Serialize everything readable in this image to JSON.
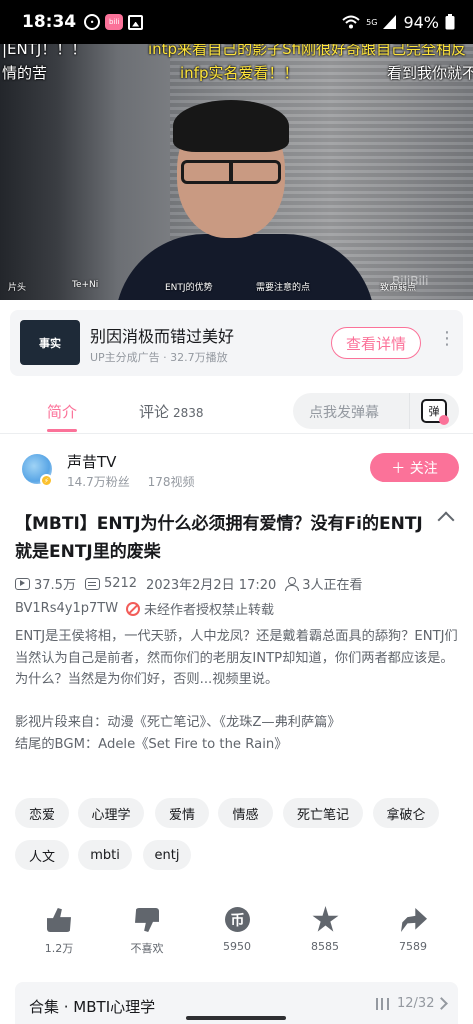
{
  "status_bar": {
    "time": "18:34",
    "network": "5G",
    "battery": "94%",
    "app_badge": "bili",
    "icons": [
      "alarm-icon",
      "bili-notification-icon",
      "image-icon",
      "wifi-icon",
      "signal-icon",
      "battery-icon"
    ]
  },
  "video": {
    "danmaku": [
      {
        "text": "|ENTJ！！！",
        "color": "#ffffff"
      },
      {
        "text": "intp来看自己的影子Sfi刚很好奇跟自己完全相反",
        "color": "#ffe53b"
      },
      {
        "text": "情的苦",
        "color": "#ffffff"
      },
      {
        "text": "infp实名爱看！！",
        "color": "#ffe53b"
      },
      {
        "text": "看到我你就不",
        "color": "#ffffff"
      }
    ],
    "chapters": [
      "片头",
      "Te+Ni",
      "ENTJ的优势",
      "需要注意的点",
      "致命弱点"
    ],
    "watermark": "BiliBili"
  },
  "ad": {
    "thumb_text": "事实",
    "title": "别因消极而错过美好",
    "subtitle": "UP主分成广告 · 32.7万播放",
    "button": "查看详情"
  },
  "tabs": {
    "intro": "简介",
    "comments": "评论",
    "comments_count": "2838",
    "danmaku_placeholder": "点我发弹幕",
    "danmaku_icon": "弹"
  },
  "uploader": {
    "name": "声昔TV",
    "fans": "14.7万粉丝",
    "videos": "178视频",
    "follow": "＋ 关注"
  },
  "video_info": {
    "title": "【MBTI】ENTJ为什么必须拥有爱情？没有Fi的ENTJ就是ENTJ里的废柴",
    "views": "37.5万",
    "danmaku_count": "5212",
    "date": "2023年2月2日 17:20",
    "watching": "3人正在看",
    "bvid": "BV1Rs4y1p7TW",
    "copyright": "未经作者授权禁止转载"
  },
  "description": [
    "ENTJ是王侯将相，一代天骄，人中龙凤？还是戴着霸总面具的舔狗？ENTJ们当然认为自己是前者，然而你们的老朋友INTP却知道，你们两者都应该是。",
    "为什么？当然是为你们好，否则...视频里说。",
    "",
    "影视片段来自：动漫《死亡笔记》、《龙珠Z—弗利萨篇》",
    "结尾的BGM：Adele《Set Fire to the Rain》"
  ],
  "tags": [
    "恋爱",
    "心理学",
    "爱情",
    "情感",
    "死亡笔记",
    "拿破仑",
    "人文",
    "mbti",
    "entj"
  ],
  "actions": {
    "like": "1.2万",
    "dislike": "不喜欢",
    "coin": "5950",
    "favorite": "8585",
    "share": "7589",
    "coin_glyph": "币"
  },
  "collection": {
    "title": "合集 · MBTI心理学",
    "progress": "12/32"
  }
}
